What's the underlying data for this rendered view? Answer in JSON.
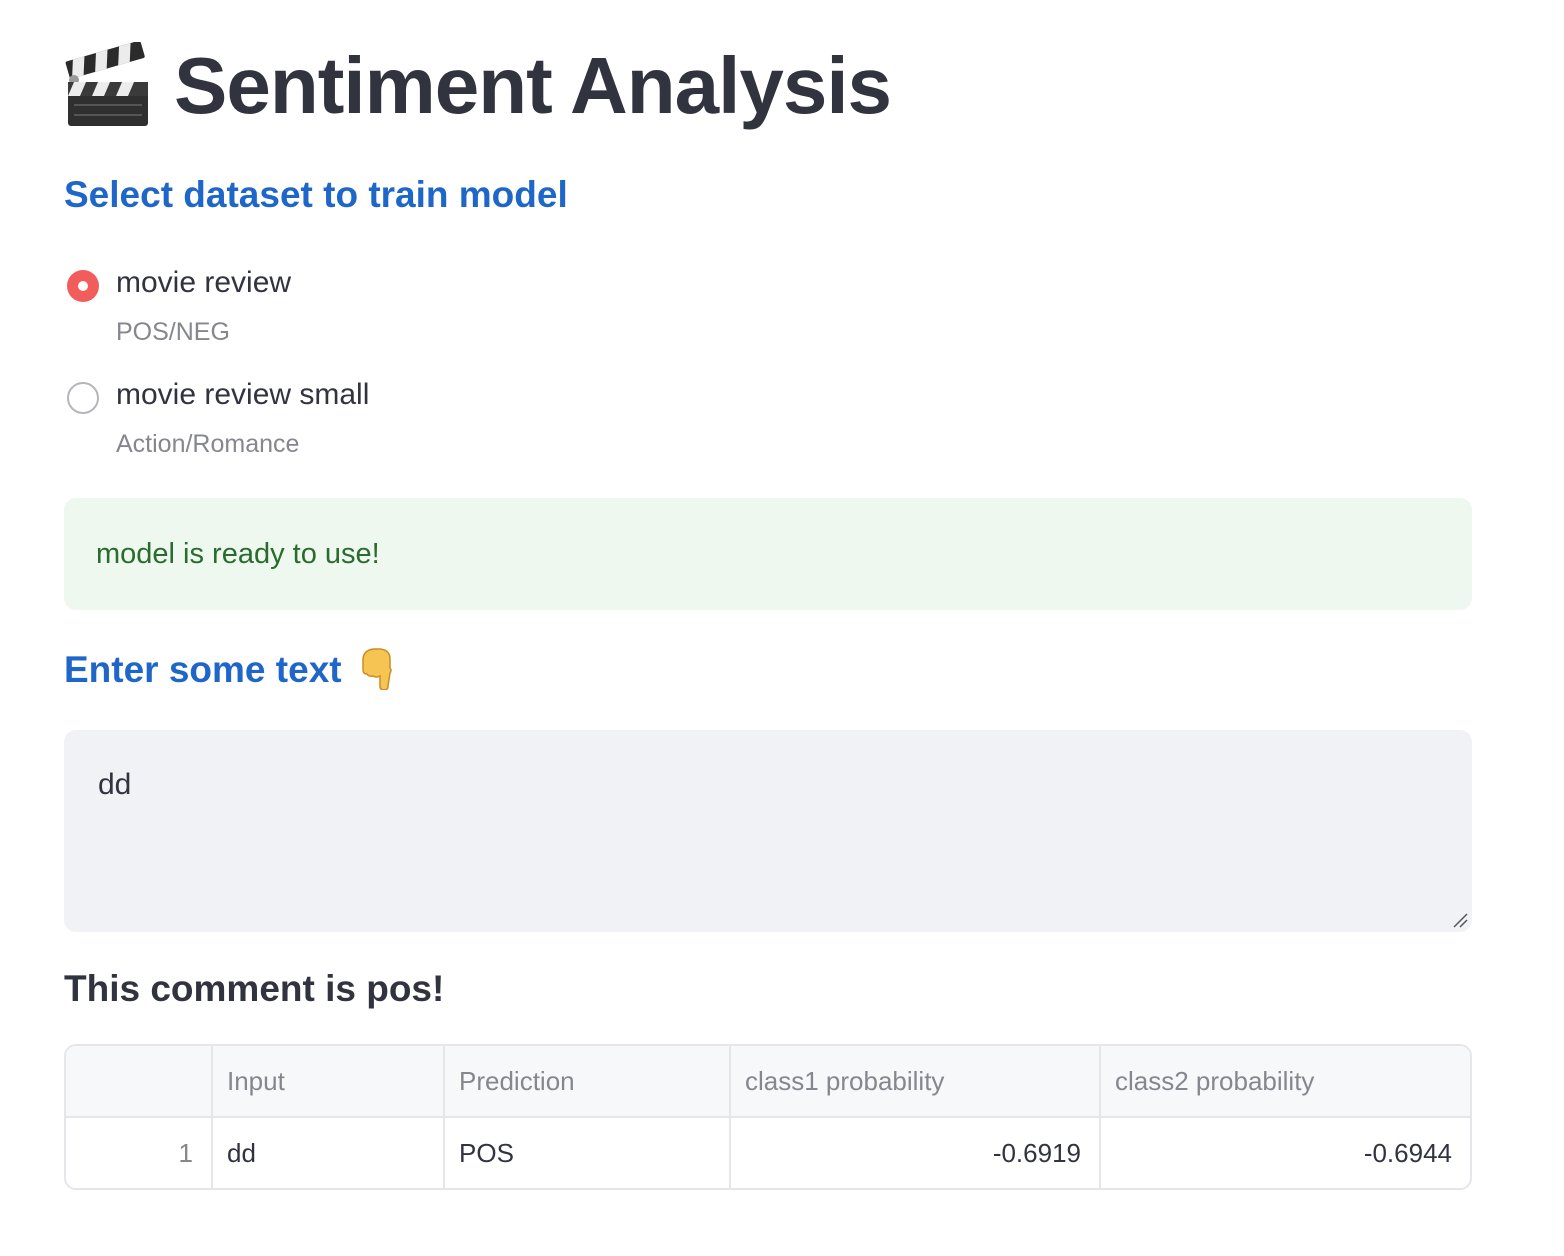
{
  "header": {
    "title": "Sentiment Analysis",
    "title_icon": "clapper-board-icon"
  },
  "dataset_section": {
    "heading": "Select dataset to train model",
    "options": [
      {
        "label": "movie review",
        "caption": "POS/NEG",
        "selected": true
      },
      {
        "label": "movie review small",
        "caption": "Action/Romance",
        "selected": false
      }
    ]
  },
  "status": {
    "message": "model is ready to use!",
    "color": "#2a6b2f",
    "background": "#eef8ee"
  },
  "input_section": {
    "heading": "Enter some text",
    "heading_icon": "pointing-down-hand-icon",
    "text_value": "dd"
  },
  "result": {
    "heading": "This comment is pos!"
  },
  "table": {
    "columns": [
      "",
      "Input",
      "Prediction",
      "class1 probability",
      "class2 probability"
    ],
    "rows": [
      {
        "index": "1",
        "input": "dd",
        "prediction": "POS",
        "class1": "-0.6919",
        "class2": "-0.6944"
      }
    ]
  },
  "colors": {
    "accent_heading": "#1f66c9",
    "radio_selected": "#f25c5a",
    "text_primary": "#31333f"
  }
}
